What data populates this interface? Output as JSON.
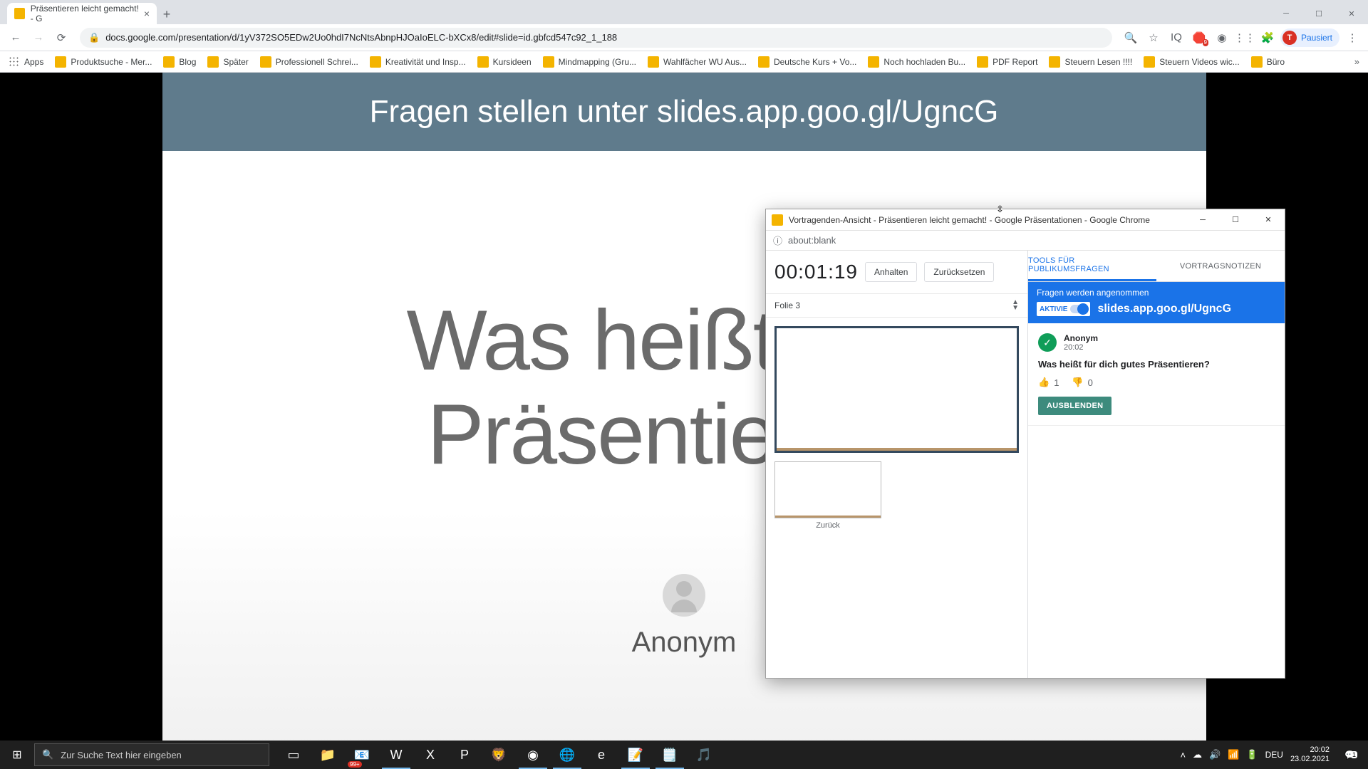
{
  "main_window": {
    "tab_title": "Präsentieren leicht gemacht! - G",
    "url": "docs.google.com/presentation/d/1yV372SO5EDw2Uo0hdI7NcNtsAbnpHJOaIoELC-bXCx8/edit#slide=id.gbfcd547c92_1_188",
    "profile_status": "Pausiert",
    "profile_initial": "T"
  },
  "bookmarks": [
    "Apps",
    "Produktsuche - Mer...",
    "Blog",
    "Später",
    "Professionell Schrei...",
    "Kreativität und Insp...",
    "Kursideen",
    "Mindmapping (Gru...",
    "Wahlfächer WU Aus...",
    "Deutsche Kurs + Vo...",
    "Noch hochladen Bu...",
    "PDF Report",
    "Steuern Lesen !!!!",
    "Steuern Videos wic...",
    "Büro"
  ],
  "banner": {
    "prefix": "Fragen stellen unter",
    "link": "slides.app.goo.gl/UgncG"
  },
  "slide": {
    "question_line1": "Was heißt für d",
    "question_line2": "Präsentieren?",
    "anonymous_label": "Anonym"
  },
  "popup": {
    "title": "Vortragenden-Ansicht - Präsentieren leicht gemacht! - Google Präsentationen - Google Chrome",
    "address": "about:blank",
    "timer": "00:01:19",
    "pause_label": "Anhalten",
    "reset_label": "Zurücksetzen",
    "slide_selector": "Folie 3",
    "prev_label": "Zurück",
    "tabs": {
      "qa": "TOOLS FÜR PUBLIKUMSFRAGEN",
      "notes": "VORTRAGSNOTIZEN"
    },
    "qa": {
      "accepting": "Fragen werden angenommen",
      "toggle_label": "AKTIVIE",
      "link": "slides.app.goo.gl/UgncG",
      "question": {
        "author": "Anonym",
        "time": "20:02",
        "text": "Was heißt für dich gutes Präsentieren?",
        "upvotes": "1",
        "downvotes": "0",
        "hide_label": "AUSBLENDEN"
      }
    }
  },
  "taskbar": {
    "search_placeholder": "Zur Suche Text hier eingeben",
    "lang": "DEU",
    "time": "20:02",
    "date": "23.02.2021",
    "notif_count": "1",
    "mail_badge": "99+"
  }
}
